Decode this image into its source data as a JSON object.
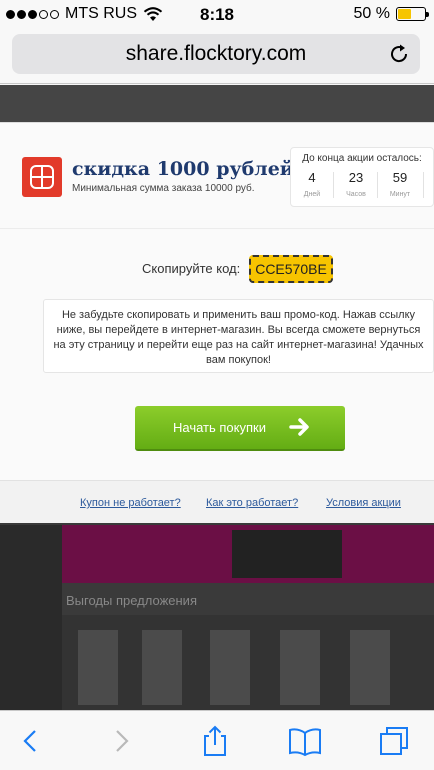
{
  "status_bar": {
    "carrier": "MTS RUS",
    "time": "8:18",
    "battery": "50 %",
    "battery_level": 0.5
  },
  "browser": {
    "url": "share.flocktory.com"
  },
  "offer": {
    "title": "скидка 1000 рублей",
    "subtitle": "Минимальная сумма заказа 10000 руб."
  },
  "timer": {
    "title": "До конца акции осталось:",
    "cells": [
      {
        "value": "4",
        "label": "Дней"
      },
      {
        "value": "23",
        "label": "Часов"
      },
      {
        "value": "59",
        "label": "Минут"
      }
    ]
  },
  "code": {
    "label": "Скопируйте код:",
    "value": "CCE570BE"
  },
  "info_text": "Не забудьте скопировать и применить ваш промо-код. Нажав ссылку ниже, вы перейдете в интернет-магазин. Вы всегда сможете вернуться на эту страницу и перейти еще раз на сайт интернет-магазина! Удачных вам покупок!",
  "cta_label": "Начать покупки",
  "footer_links": [
    "Купон не работает?",
    "Как это работает?",
    "Условия акции"
  ],
  "background": {
    "heading": "Выгоды предложения"
  },
  "colors": {
    "brand_red": "#e23a2a",
    "title_navy": "#1f3a6e",
    "code_yellow": "#f7c400",
    "cta_green": "#6fb81c",
    "link_blue": "#2d5a9c",
    "ios_blue": "#1a7cf4"
  },
  "toolbar_icons": [
    "back-icon",
    "forward-icon",
    "share-icon",
    "bookmarks-icon",
    "tabs-icon"
  ]
}
